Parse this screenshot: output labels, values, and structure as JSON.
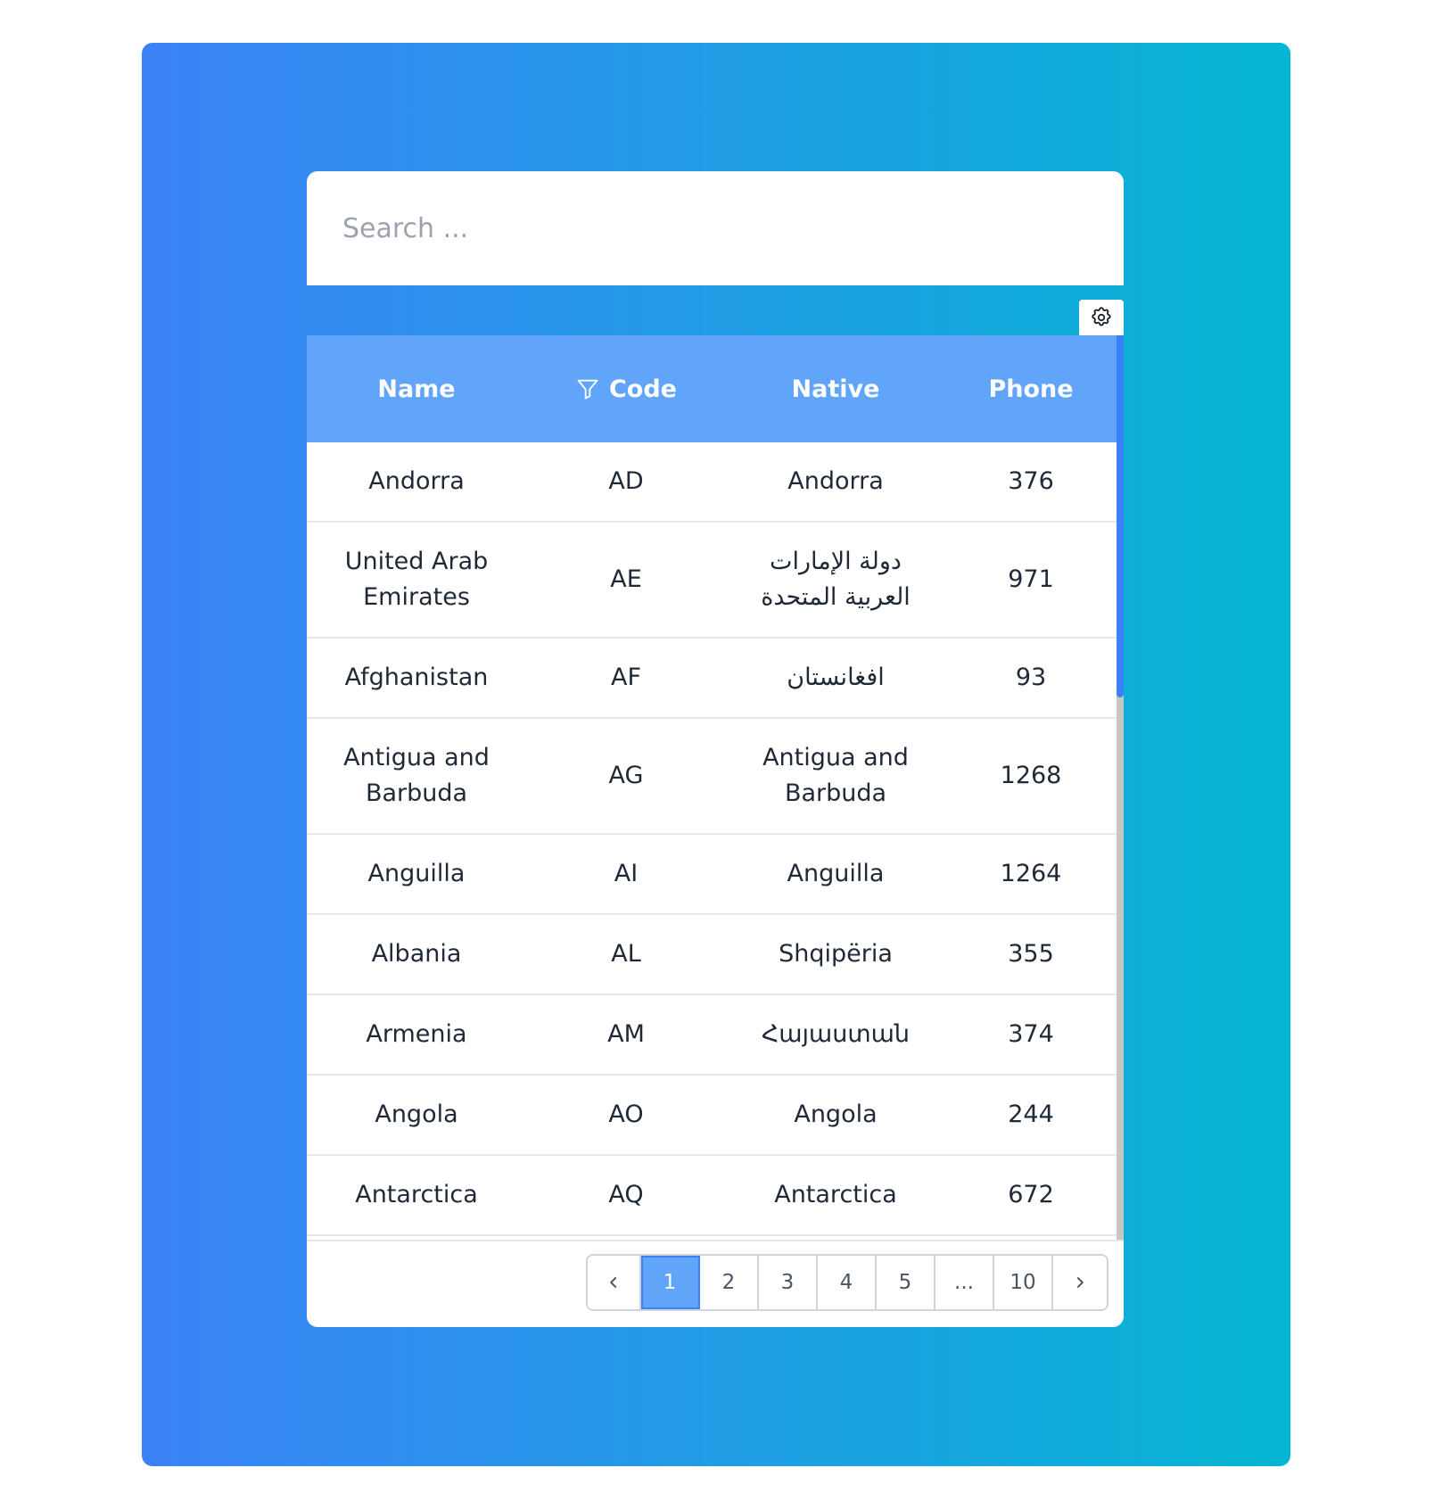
{
  "search": {
    "placeholder": "Search ..."
  },
  "table": {
    "headers": {
      "name": "Name",
      "code": "Code",
      "native": "Native",
      "phone": "Phone"
    },
    "rows": [
      {
        "name": "Andorra",
        "code": "AD",
        "native": "Andorra",
        "phone": "376"
      },
      {
        "name": "United Arab Emirates",
        "code": "AE",
        "native": "دولة الإمارات العربية المتحدة",
        "phone": "971"
      },
      {
        "name": "Afghanistan",
        "code": "AF",
        "native": "افغانستان",
        "phone": "93"
      },
      {
        "name": "Antigua and Barbuda",
        "code": "AG",
        "native": "Antigua and Barbuda",
        "phone": "1268"
      },
      {
        "name": "Anguilla",
        "code": "AI",
        "native": "Anguilla",
        "phone": "1264"
      },
      {
        "name": "Albania",
        "code": "AL",
        "native": "Shqipëria",
        "phone": "355"
      },
      {
        "name": "Armenia",
        "code": "AM",
        "native": "Հայաստան",
        "phone": "374"
      },
      {
        "name": "Angola",
        "code": "AO",
        "native": "Angola",
        "phone": "244"
      },
      {
        "name": "Antarctica",
        "code": "AQ",
        "native": "Antarctica",
        "phone": "672"
      }
    ]
  },
  "pagination": {
    "pages": [
      "1",
      "2",
      "3",
      "4",
      "5",
      "...",
      "10"
    ],
    "active": "1"
  },
  "icons": {
    "settings": "gear-icon",
    "filter": "filter-icon",
    "prev": "chevron-left-icon",
    "next": "chevron-right-icon"
  },
  "colors": {
    "gradient_start": "#3b82f6",
    "gradient_end": "#06b6d4",
    "header_bg": "#60a5fa",
    "active_page": "#60a5fa"
  }
}
